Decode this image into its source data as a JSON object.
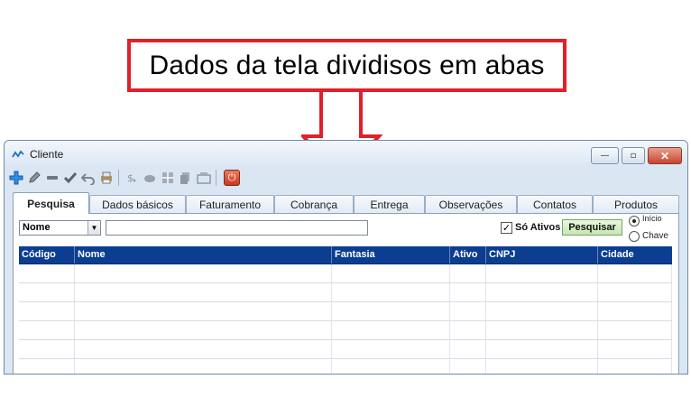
{
  "annotation": {
    "text": "Dados da tela dividisos em abas"
  },
  "window": {
    "title": "Cliente",
    "buttons": {
      "min": "—",
      "max": "▫",
      "close": "✕"
    }
  },
  "toolbar": {
    "icons": [
      "add-icon",
      "edit-icon",
      "remove-icon",
      "confirm-icon",
      "undo-icon",
      "print-icon",
      "money-icon",
      "hand-icon",
      "grid-icon",
      "copy-icon",
      "duplicate-icon",
      "power-icon"
    ]
  },
  "tabs": [
    "Pesquisa",
    "Dados básicos",
    "Faturamento",
    "Cobrança",
    "Entrega",
    "Observações",
    "Contatos",
    "Produtos"
  ],
  "search": {
    "field": "Nome",
    "value": "",
    "only_active_label": "Só Ativos",
    "only_active_checked": true,
    "button": "Pesquisar",
    "radio_top": "Início",
    "radio_bottom": "Chave"
  },
  "grid": {
    "columns": [
      "Código",
      "Nome",
      "Fantasia",
      "Ativo",
      "CNPJ",
      "Cidade"
    ],
    "rows": [
      [
        "",
        "",
        "",
        "",
        "",
        ""
      ],
      [
        "",
        "",
        "",
        "",
        "",
        ""
      ],
      [
        "",
        "",
        "",
        "",
        "",
        ""
      ],
      [
        "",
        "",
        "",
        "",
        "",
        ""
      ],
      [
        "",
        "",
        "",
        "",
        "",
        ""
      ],
      [
        "",
        "",
        "",
        "",
        "",
        ""
      ]
    ]
  },
  "colors": {
    "annotation_red": "#e0202a",
    "grid_header": "#0b3d91",
    "search_button": "#c6e6b0"
  }
}
